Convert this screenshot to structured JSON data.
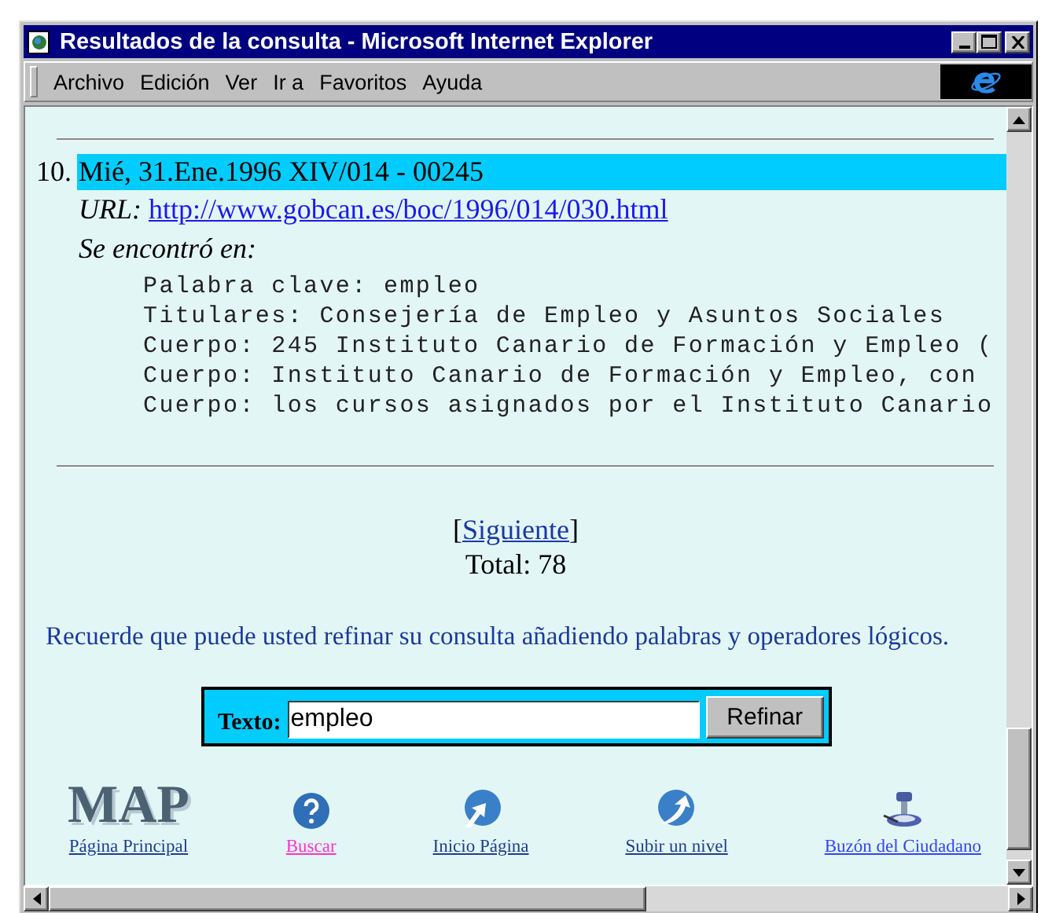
{
  "window": {
    "title": "Resultados de la consulta - Microsoft Internet Explorer"
  },
  "menu": [
    "Archivo",
    "Edición",
    "Ver",
    "Ir a",
    "Favoritos",
    "Ayuda"
  ],
  "result": {
    "number": "10.",
    "heading": "Mié, 31.Ene.1996 XIV/014 - 00245",
    "highlighted": true,
    "url_label": "URL:",
    "url": "http://www.gobcan.es/boc/1996/014/030.html",
    "found_label": "Se encontró en:",
    "matches": [
      "Palabra clave: empleo",
      "Titulares: Consejería de Empleo y Asuntos Sociales",
      "Cuerpo: 245 Instituto Canario de Formación y Empleo (",
      "Cuerpo: Instituto Canario de Formación y Empleo, con",
      "Cuerpo: los cursos asignados por el Instituto Canario"
    ]
  },
  "pager": {
    "open": "[",
    "next": "Siguiente",
    "close": "]",
    "total": "Total: 78"
  },
  "hint": "Recuerde que puede usted refinar su consulta añadiendo palabras y operadores lógicos.",
  "refine": {
    "label": "Texto:",
    "value": "empleo",
    "button": "Refinar"
  },
  "footer": {
    "logo": "MAP",
    "links": [
      {
        "label": "Página Principal",
        "kind": "logo",
        "color": "#1f3f8f"
      },
      {
        "label": "Buscar",
        "kind": "help",
        "color": "#ff33cc"
      },
      {
        "label": "Inicio Página",
        "kind": "up",
        "color": "#1f3f8f"
      },
      {
        "label": "Subir un nivel",
        "kind": "back",
        "color": "#1f3f8f"
      },
      {
        "label": "Buzón del Ciudadano",
        "kind": "mailbox",
        "color": "#3344ff"
      }
    ]
  }
}
